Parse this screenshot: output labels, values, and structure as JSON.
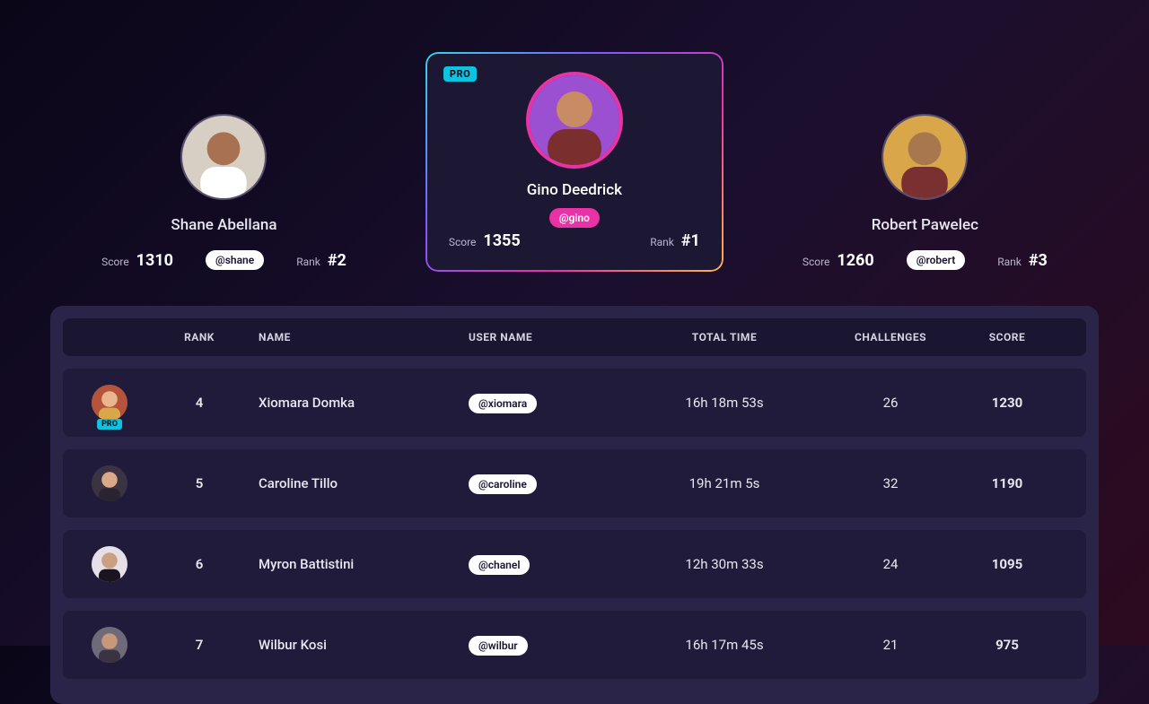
{
  "labels": {
    "score": "Score",
    "rank": "Rank",
    "pro": "PRO"
  },
  "podium": {
    "second": {
      "name": "Shane Abellana",
      "handle": "@shane",
      "score": "1310",
      "rank": "#2"
    },
    "first": {
      "name": "Gino Deedrick",
      "handle": "@gino",
      "score": "1355",
      "rank": "#1",
      "pro": true
    },
    "third": {
      "name": "Robert Pawelec",
      "handle": "@robert",
      "score": "1260",
      "rank": "#3"
    }
  },
  "table": {
    "headers": {
      "rank": "RANK",
      "name": "NAME",
      "username": "USER NAME",
      "totalTime": "TOTAL TIME",
      "challenges": "CHALLENGES",
      "score": "SCORE"
    },
    "rows": [
      {
        "rank": "4",
        "name": "Xiomara Domka",
        "username": "@xiomara",
        "time": "16h 18m 53s",
        "challenges": "26",
        "score": "1230",
        "pro": true
      },
      {
        "rank": "5",
        "name": "Caroline Tillo",
        "username": "@caroline",
        "time": "19h 21m 5s",
        "challenges": "32",
        "score": "1190",
        "pro": false
      },
      {
        "rank": "6",
        "name": "Myron Battistini",
        "username": "@chanel",
        "time": "12h 30m 33s",
        "challenges": "24",
        "score": "1095",
        "pro": false
      },
      {
        "rank": "7",
        "name": "Wilbur Kosi",
        "username": "@wilbur",
        "time": "16h 17m 45s",
        "challenges": "21",
        "score": "975",
        "pro": false
      }
    ]
  },
  "avatars": {
    "shane": {
      "bg": "#d8cfc4",
      "skin": "#a87252",
      "shirt": "#ffffff"
    },
    "gino": {
      "bg": "#9b4fd1",
      "skin": "#c98b63",
      "shirt": "#7a2e2e"
    },
    "robert": {
      "bg": "#d9a64a",
      "skin": "#a8774e",
      "shirt": "#7a3030"
    },
    "row0": {
      "bg": "#b5543a",
      "skin": "#e9b690",
      "shirt": "#d9a64a"
    },
    "row1": {
      "bg": "#3a3342",
      "skin": "#d9a98a",
      "shirt": "#2a2430"
    },
    "row2": {
      "bg": "#e5dfe8",
      "skin": "#caa080",
      "shirt": "#1a1420"
    },
    "row3": {
      "bg": "#6e6a7a",
      "skin": "#c89878",
      "shirt": "#3a3342"
    }
  }
}
